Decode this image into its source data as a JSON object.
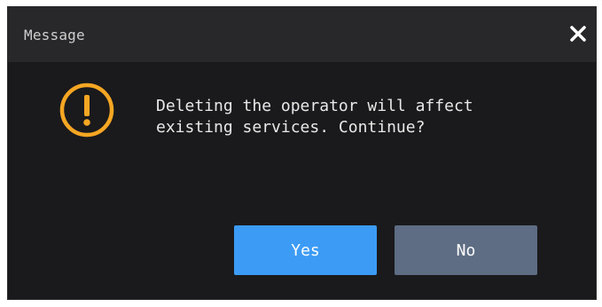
{
  "dialog": {
    "title": "Message",
    "message": "Deleting the operator will affect\nexisting services. Continue?",
    "icon": "warning-icon",
    "close_icon": "close-icon"
  },
  "buttons": {
    "yes_label": "Yes",
    "no_label": "No"
  },
  "colors": {
    "background": "#1a1a1c",
    "titlebar": "#28282b",
    "warning": "#f5a623",
    "yes_button": "#3b9bf5",
    "no_button": "#5e6d84"
  }
}
